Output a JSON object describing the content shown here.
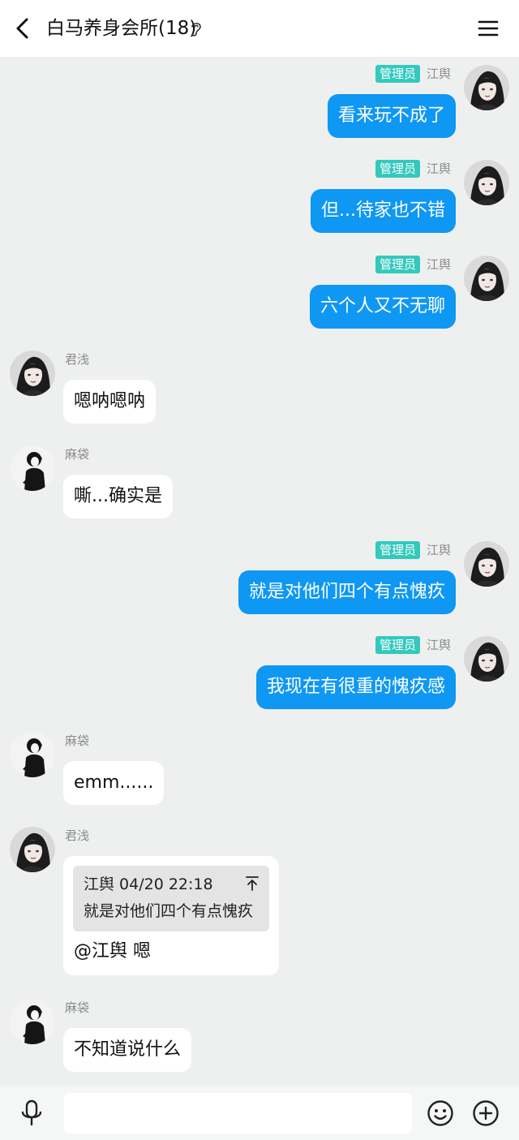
{
  "header": {
    "title": "白马养身会所(18)",
    "back_icon": "chevron-left-icon",
    "ear_icon": "ear-icon",
    "menu_icon": "hamburger-menu-icon"
  },
  "colors": {
    "outgoing_bubble": "#0f97f4",
    "incoming_bubble": "#ffffff",
    "admin_badge": "#33c9bd",
    "background": "#eef0ef"
  },
  "messages": [
    {
      "direction": "out",
      "badge": "管理员",
      "sender": "江舆",
      "text": "看来玩不成了"
    },
    {
      "direction": "out",
      "badge": "管理员",
      "sender": "江舆",
      "text": "但...待家也不错"
    },
    {
      "direction": "out",
      "badge": "管理员",
      "sender": "江舆",
      "text": "六个人又不无聊"
    },
    {
      "direction": "in",
      "sender": "君浅",
      "text": "嗯呐嗯呐"
    },
    {
      "direction": "in",
      "sender": "麻袋",
      "text": "嘶...确实是"
    },
    {
      "direction": "out",
      "badge": "管理员",
      "sender": "江舆",
      "text": "就是对他们四个有点愧疚"
    },
    {
      "direction": "out",
      "badge": "管理员",
      "sender": "江舆",
      "text": "我现在有很重的愧疚感"
    },
    {
      "direction": "in",
      "sender": "麻袋",
      "text": "emm......"
    },
    {
      "direction": "in",
      "sender": "君浅",
      "quote": {
        "head": "江舆 04/20 22:18",
        "body": "就是对他们四个有点愧疚",
        "icon": "jump-to-top-icon"
      },
      "text": "@江舆 嗯"
    },
    {
      "direction": "in",
      "sender": "麻袋",
      "text": "不知道说什么"
    }
  ],
  "input_bar": {
    "mic_icon": "microphone-icon",
    "input_value": "",
    "emoji_icon": "smiley-icon",
    "plus_icon": "add-circle-icon"
  }
}
